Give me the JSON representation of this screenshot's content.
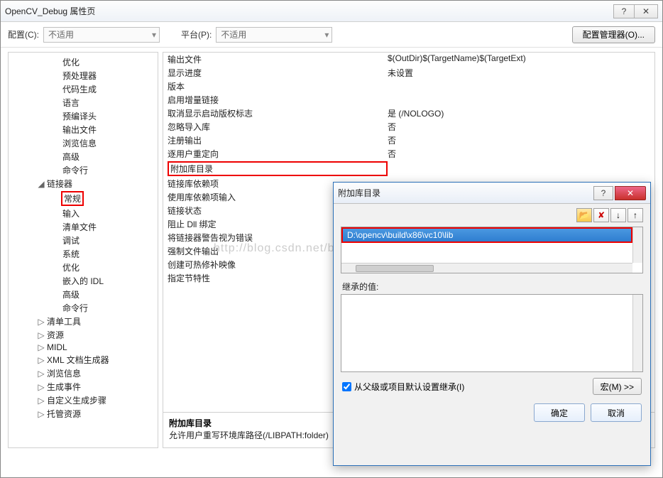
{
  "titlebar": {
    "title": "OpenCV_Debug 属性页"
  },
  "toprow": {
    "config_label": "配置(C):",
    "config_value": "不适用",
    "platform_label": "平台(P):",
    "platform_value": "不适用",
    "config_mgr": "配置管理器(O)..."
  },
  "tree": {
    "items": [
      {
        "depth": 3,
        "label": "优化"
      },
      {
        "depth": 3,
        "label": "预处理器"
      },
      {
        "depth": 3,
        "label": "代码生成"
      },
      {
        "depth": 3,
        "label": "语言"
      },
      {
        "depth": 3,
        "label": "预编译头"
      },
      {
        "depth": 3,
        "label": "输出文件"
      },
      {
        "depth": 3,
        "label": "浏览信息"
      },
      {
        "depth": 3,
        "label": "高级"
      },
      {
        "depth": 3,
        "label": "命令行"
      },
      {
        "depth": 2,
        "label": "链接器",
        "tw": "◢"
      },
      {
        "depth": 3,
        "label": "常规",
        "hi": true
      },
      {
        "depth": 3,
        "label": "输入"
      },
      {
        "depth": 3,
        "label": "清单文件"
      },
      {
        "depth": 3,
        "label": "调试"
      },
      {
        "depth": 3,
        "label": "系统"
      },
      {
        "depth": 3,
        "label": "优化"
      },
      {
        "depth": 3,
        "label": "嵌入的 IDL"
      },
      {
        "depth": 3,
        "label": "高级"
      },
      {
        "depth": 3,
        "label": "命令行"
      },
      {
        "depth": 2,
        "label": "清单工具",
        "tw": "▷"
      },
      {
        "depth": 2,
        "label": "资源",
        "tw": "▷"
      },
      {
        "depth": 2,
        "label": "MIDL",
        "tw": "▷"
      },
      {
        "depth": 2,
        "label": "XML 文档生成器",
        "tw": "▷"
      },
      {
        "depth": 2,
        "label": "浏览信息",
        "tw": "▷"
      },
      {
        "depth": 2,
        "label": "生成事件",
        "tw": "▷"
      },
      {
        "depth": 2,
        "label": "自定义生成步骤",
        "tw": "▷"
      },
      {
        "depth": 2,
        "label": "托管资源",
        "tw": "▷"
      }
    ]
  },
  "props": {
    "rows": [
      {
        "k": "输出文件",
        "v": "$(OutDir)$(TargetName)$(TargetExt)"
      },
      {
        "k": "显示进度",
        "v": "未设置"
      },
      {
        "k": "版本",
        "v": ""
      },
      {
        "k": "启用增量链接",
        "v": ""
      },
      {
        "k": "取消显示启动版权标志",
        "v": "是 (/NOLOGO)"
      },
      {
        "k": "忽略导入库",
        "v": "否"
      },
      {
        "k": "注册输出",
        "v": "否"
      },
      {
        "k": "逐用户重定向",
        "v": "否"
      },
      {
        "k": "附加库目录",
        "v": "",
        "hi": true
      },
      {
        "k": "链接库依赖项",
        "v": ""
      },
      {
        "k": "使用库依赖项输入",
        "v": ""
      },
      {
        "k": "链接状态",
        "v": ""
      },
      {
        "k": "阻止 Dll 绑定",
        "v": ""
      },
      {
        "k": "将链接器警告视为错误",
        "v": ""
      },
      {
        "k": "强制文件输出",
        "v": ""
      },
      {
        "k": "创建可热修补映像",
        "v": ""
      },
      {
        "k": "指定节特性",
        "v": ""
      }
    ],
    "desc_title": "附加库目录",
    "desc_text": "允许用户重写环境库路径(/LIBPATH:folder)"
  },
  "watermark": "http://blog.csdn.net/bendanban",
  "dialog": {
    "title": "附加库目录",
    "path": "D:\\opencv\\build\\x86\\vc10\\lib",
    "inherited_label": "继承的值:",
    "inherit_checkbox": "从父级或项目默认设置继承(I)",
    "macro_btn": "宏(M) >>",
    "ok": "确定",
    "cancel": "取消"
  }
}
